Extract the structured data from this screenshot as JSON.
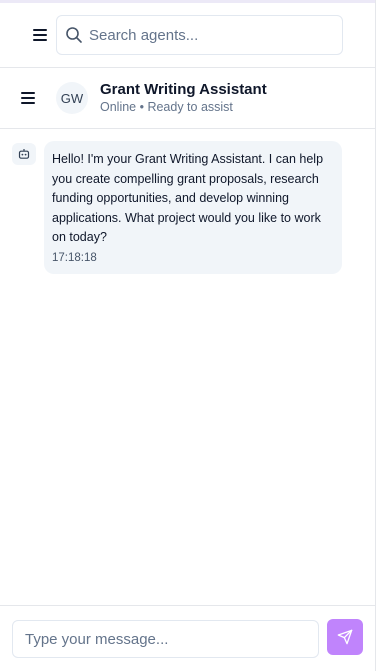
{
  "search": {
    "placeholder": "Search agents..."
  },
  "agent": {
    "initials": "GW",
    "name": "Grant Writing Assistant",
    "status": "Online • Ready to assist"
  },
  "messages": [
    {
      "sender": "bot",
      "text": "Hello! I'm your Grant Writing Assistant. I can help you create compelling grant proposals, research funding opportunities, and develop winning applications. What project would you like to work on today?",
      "time": "17:18:18"
    }
  ],
  "composer": {
    "placeholder": "Type your message..."
  },
  "colors": {
    "accent": "#c084fc",
    "bubble": "#f1f5f9",
    "border": "#e5e7eb",
    "muted_text": "#64748b"
  },
  "icons": {
    "menu": "menu-icon",
    "search": "search-icon",
    "bot": "bot-icon",
    "send": "send-icon"
  }
}
